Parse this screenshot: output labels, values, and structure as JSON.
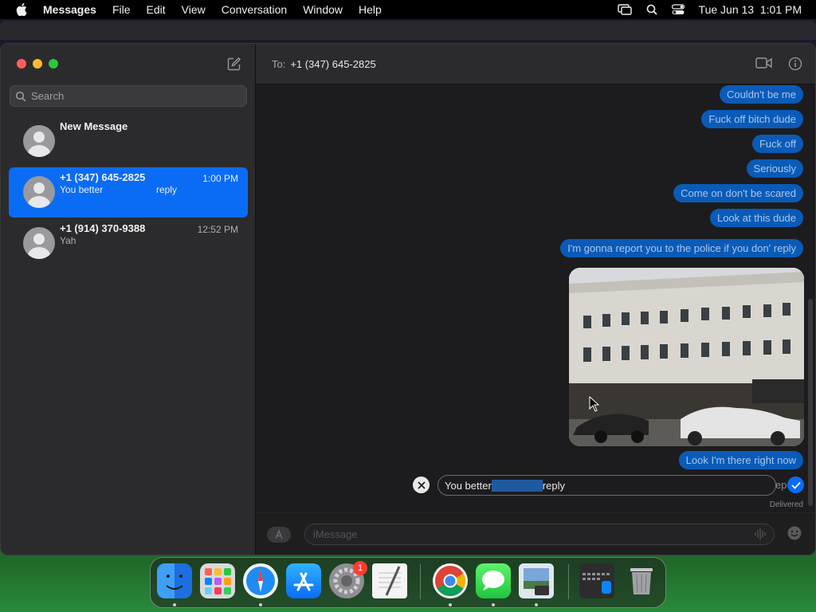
{
  "menubar": {
    "app_name": "Messages",
    "items": [
      "File",
      "Edit",
      "View",
      "Conversation",
      "Window",
      "Help"
    ],
    "clock": "Tue Jun 13  1:01 PM"
  },
  "sidebar": {
    "search_placeholder": "Search",
    "conversations": [
      {
        "name": "New Message",
        "preview": "",
        "time": ""
      },
      {
        "name": "+1 (347) 645-2825",
        "preview": "You better                    reply",
        "time": "1:00 PM"
      },
      {
        "name": "+1 (914) 370-9388",
        "preview": "Yah",
        "time": "12:52 PM"
      }
    ]
  },
  "header": {
    "to_label": "To:",
    "to_value": "+1 (347) 645-2825"
  },
  "messages": [
    "Couldn't be me",
    "Fuck off bitch dude",
    "Fuck off",
    "Seriously",
    "Come on don't be scared",
    "Look at this dude",
    "I'm gonna report you to the police if you don' reply",
    "Look I'm there right now"
  ],
  "edit": {
    "text_before": "You better",
    "text_after": "reply",
    "tail": "ep"
  },
  "status": {
    "delivered": "Delivered"
  },
  "composer": {
    "placeholder": "iMessage"
  },
  "dock": {
    "badge_count": "1",
    "apps": [
      "Finder",
      "Launchpad",
      "Safari",
      "App Store",
      "System Settings",
      "TextEdit",
      "Chrome",
      "Messages",
      "Preview",
      "Screenshot",
      "Trash"
    ]
  },
  "colors": {
    "selection": "#0a6cf5",
    "bubble": "#0a5bb8",
    "bubble_text": "#a9c6ea"
  }
}
